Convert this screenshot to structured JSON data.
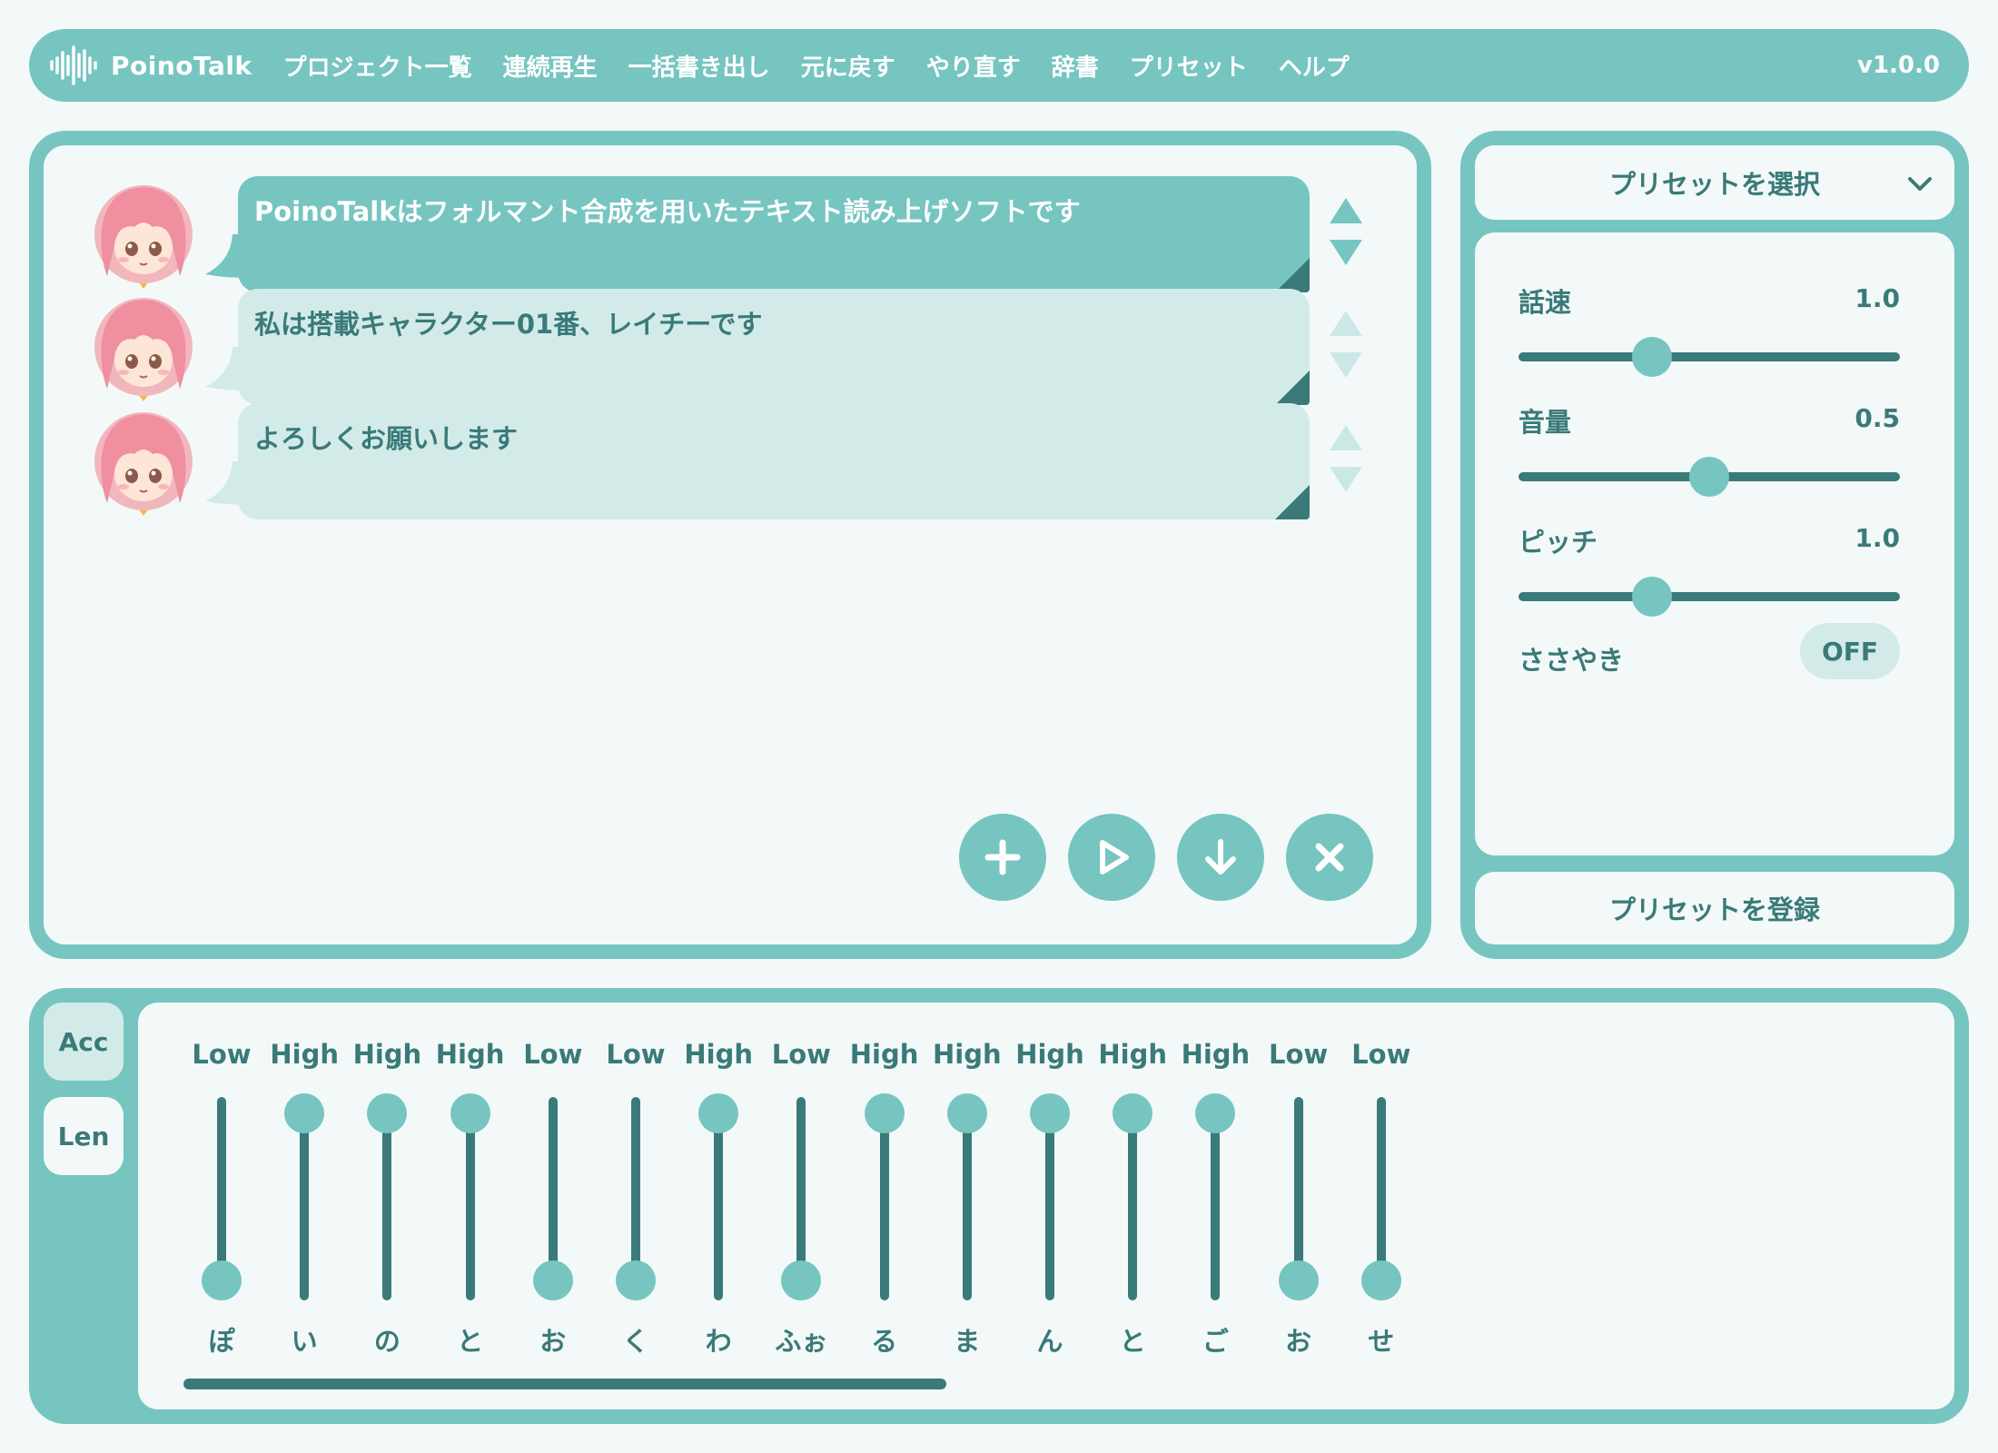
{
  "app": {
    "title": "PoinoTalk",
    "version": "v1.0.0",
    "logo_icon": "waveform-icon"
  },
  "menu": [
    "プロジェクト一覧",
    "連続再生",
    "一括書き出し",
    "元に戻す",
    "やり直す",
    "辞書",
    "プリセット",
    "ヘルプ"
  ],
  "talk_rows": [
    {
      "text": "PoinoTalkはフォルマント合成を用いたテキスト読み上げソフトです",
      "active": true
    },
    {
      "text": "私は搭載キャラクター01番、レイチーです",
      "active": false
    },
    {
      "text": "よろしくお願いします",
      "active": false
    }
  ],
  "actions": [
    {
      "name": "add-row-button",
      "icon": "plus-icon"
    },
    {
      "name": "play-button",
      "icon": "play-icon"
    },
    {
      "name": "export-button",
      "icon": "download-icon"
    },
    {
      "name": "delete-button",
      "icon": "close-icon"
    }
  ],
  "preset": {
    "select_label": "プリセットを選択",
    "register_label": "プリセットを登録",
    "params": [
      {
        "label": "話速",
        "value": "1.0",
        "level": 0.35
      },
      {
        "label": "音量",
        "value": "0.5",
        "level": 0.5
      },
      {
        "label": "ピッチ",
        "value": "1.0",
        "level": 0.35
      }
    ],
    "whisper": {
      "label": "ささやき",
      "state": "OFF"
    }
  },
  "bottom": {
    "tabs": [
      "Acc",
      "Len"
    ],
    "selected_tab": "Acc",
    "morae": [
      {
        "char": "ぽ",
        "level": "Low"
      },
      {
        "char": "い",
        "level": "High"
      },
      {
        "char": "の",
        "level": "High"
      },
      {
        "char": "と",
        "level": "High"
      },
      {
        "char": "お",
        "level": "Low"
      },
      {
        "char": "く",
        "level": "Low"
      },
      {
        "char": "わ",
        "level": "High"
      },
      {
        "char": "ふぉ",
        "level": "Low"
      },
      {
        "char": "る",
        "level": "High"
      },
      {
        "char": "ま",
        "level": "High"
      },
      {
        "char": "ん",
        "level": "High"
      },
      {
        "char": "と",
        "level": "High"
      },
      {
        "char": "ご",
        "level": "High"
      },
      {
        "char": "お",
        "level": "Low"
      },
      {
        "char": "せ",
        "level": "Low"
      }
    ]
  },
  "colors": {
    "teal": "#76c5c1",
    "dark_teal": "#3a7a78",
    "pale_teal": "#d2ebe9",
    "background": "#f3f9f9"
  }
}
